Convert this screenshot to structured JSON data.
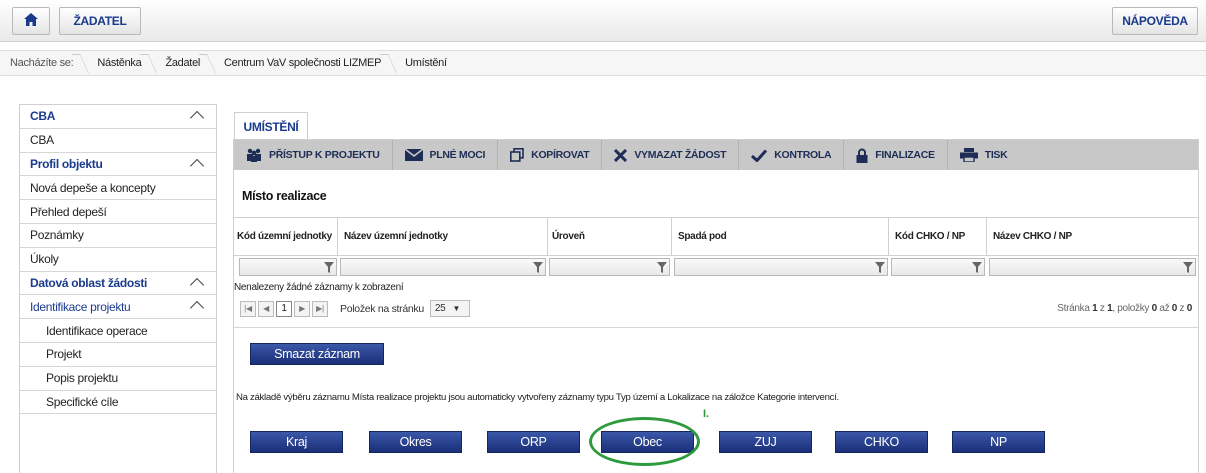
{
  "header": {
    "home_icon": "home-icon",
    "zadatel_label": "ŽADATEL",
    "help_label": "NÁPOVĚDA"
  },
  "breadcrumb": {
    "lead": "Nacházíte se:",
    "items": [
      "Nástěnka",
      "Žadatel",
      "Centrum VaV společnosti LIZMEP",
      "Umístění"
    ]
  },
  "sidebar": {
    "items": [
      {
        "label": "CBA",
        "type": "group"
      },
      {
        "label": "CBA",
        "type": "item"
      },
      {
        "label": "Profil objektu",
        "type": "group"
      },
      {
        "label": "Nová depeše a koncepty",
        "type": "item"
      },
      {
        "label": "Přehled depeší",
        "type": "item"
      },
      {
        "label": "Poznámky",
        "type": "item"
      },
      {
        "label": "Úkoly",
        "type": "item"
      },
      {
        "label": "Datová oblast žádosti",
        "type": "group"
      },
      {
        "label": "Identifikace projektu",
        "type": "group-open"
      },
      {
        "label": "Identifikace operace",
        "type": "child"
      },
      {
        "label": "Projekt",
        "type": "child"
      },
      {
        "label": "Popis projektu",
        "type": "child"
      },
      {
        "label": "Specifické cíle",
        "type": "child"
      }
    ]
  },
  "main": {
    "tab_label": "UMÍSTĚNÍ",
    "toolbar": {
      "access": "PŘÍSTUP K PROJEKTU",
      "power": "PLNÉ MOCI",
      "copy": "KOPÍROVAT",
      "delete": "VYMAZAT ŽÁDOST",
      "check": "KONTROLA",
      "finalize": "FINALIZACE",
      "print": "TISK"
    },
    "section_title": "Místo realizace",
    "columns": {
      "c1": "Kód územní jednotky",
      "c2": "Název územní jednotky",
      "c3": "Úroveň",
      "c4": "Spadá pod",
      "c5": "Kód CHKO / NP",
      "c6": "Název CHKO / NP"
    },
    "empty_text": "Nenalezeny žádné záznamy k zobrazení",
    "pager": {
      "page": "1",
      "per_page_label": "Položek na stránku",
      "per_page_value": "25",
      "info_prefix": "Stránka",
      "info_page": "1",
      "info_of": "z",
      "info_total": "1",
      "info_items": ", položky",
      "info_from": "0",
      "info_to_word": "až",
      "info_to": "0",
      "info_z": "z",
      "info_count": "0"
    },
    "delete_record": "Smazat záznam",
    "info_text": "Na základě výběru záznamu Místa realizace projektu jsou automaticky vytvořeny záznamy typu Typ území a Lokalizace na záložce Kategorie intervencí.",
    "marker": "I.",
    "levels": [
      "Kraj",
      "Okres",
      "ORP",
      "Obec",
      "ZUJ",
      "CHKO",
      "NP"
    ]
  },
  "colors": {
    "accent": "#1a3a8c",
    "button": "#1b2f78",
    "highlight": "#2e9a3e"
  }
}
